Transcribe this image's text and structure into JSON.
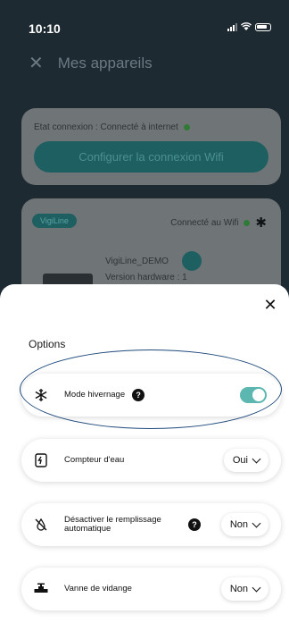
{
  "status_bar": {
    "time": "10:10"
  },
  "background": {
    "header_title": "Mes appareils",
    "connection_status": "Etat connexion : Connecté à internet",
    "configure_wifi_button": "Configurer la connexion Wifi",
    "device_badge": "VigiLine",
    "wifi_status": "Connecté au Wifi",
    "device_name": "VigiLine_DEMO",
    "version_truncated": "Version hardware : 1"
  },
  "options_modal": {
    "title": "Options",
    "items": [
      {
        "label": "Mode hivernage",
        "icon": "snowflake-icon",
        "has_help": true,
        "control": "toggle",
        "value": "on"
      },
      {
        "label": "Compteur d'eau",
        "icon": "water-meter-icon",
        "has_help": false,
        "control": "select",
        "value": "Oui"
      },
      {
        "label": "Désactiver le remplissage automatique",
        "icon": "no-fill-icon",
        "has_help": true,
        "control": "select",
        "value": "Non"
      },
      {
        "label": "Vanne de vidange",
        "icon": "drain-valve-icon",
        "has_help": false,
        "control": "select",
        "value": "Non"
      }
    ]
  },
  "colors": {
    "toggle_on": "#5bb7b0",
    "status_dot": "#2f7a36",
    "annotation_ellipse": "#1f4a7c"
  }
}
